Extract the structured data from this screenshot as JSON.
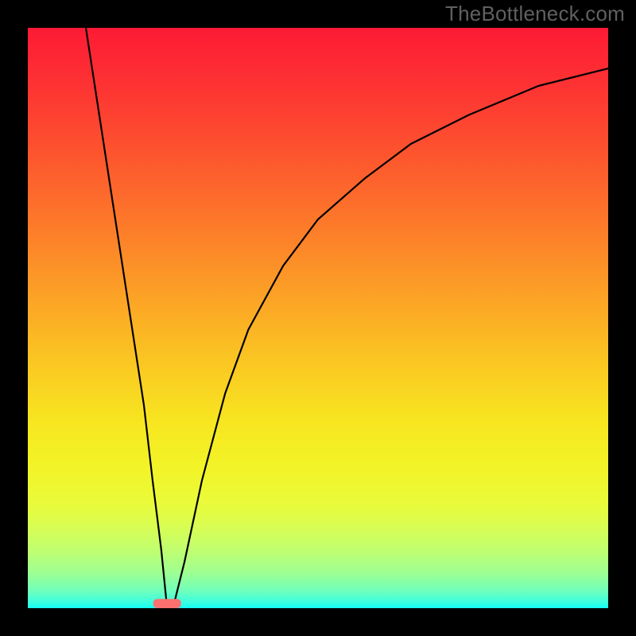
{
  "watermark": "TheBottleneck.com",
  "chart_data": {
    "type": "line",
    "title": "",
    "xlabel": "",
    "ylabel": "",
    "xlim": [
      0,
      100
    ],
    "ylim": [
      0,
      100
    ],
    "grid": false,
    "series": [
      {
        "name": "curve",
        "x": [
          10,
          12,
          14,
          16,
          18,
          20,
          21.5,
          23,
          24,
          25,
          27,
          30,
          34,
          38,
          44,
          50,
          58,
          66,
          76,
          88,
          100
        ],
        "y": [
          100,
          87,
          74,
          61,
          48,
          35,
          22,
          10,
          0,
          0,
          8,
          22,
          37,
          48,
          59,
          67,
          74,
          80,
          85,
          90,
          93
        ]
      }
    ],
    "marker": {
      "x": 24,
      "y": 0,
      "width": 4.8,
      "height": 1.6
    },
    "background": {
      "type": "vertical-gradient",
      "stops": [
        {
          "pos": 0.0,
          "color": "#fd1a35"
        },
        {
          "pos": 0.22,
          "color": "#fd552e"
        },
        {
          "pos": 0.46,
          "color": "#fca126"
        },
        {
          "pos": 0.68,
          "color": "#f7e620"
        },
        {
          "pos": 0.86,
          "color": "#d8fd53"
        },
        {
          "pos": 0.97,
          "color": "#6fffbc"
        },
        {
          "pos": 1.0,
          "color": "#14fff6"
        }
      ]
    }
  }
}
